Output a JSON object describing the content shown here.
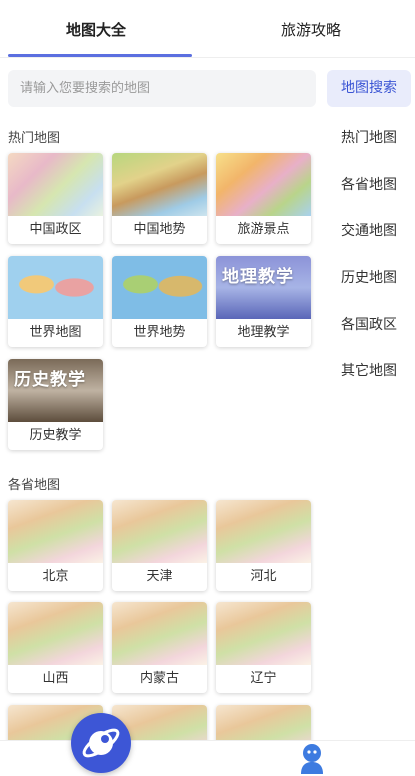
{
  "tabs": [
    {
      "label": "地图大全",
      "active": true
    },
    {
      "label": "旅游攻略",
      "active": false
    }
  ],
  "search": {
    "placeholder": "请输入您要搜索的地图",
    "button_label": "地图搜索"
  },
  "sections": {
    "hot": {
      "title": "热门地图",
      "items": [
        {
          "label": "中国政区",
          "image": "china-political-map"
        },
        {
          "label": "中国地势",
          "image": "china-terrain-map"
        },
        {
          "label": "旅游景点",
          "image": "tourist-attractions-map"
        },
        {
          "label": "世界地图",
          "image": "world-map"
        },
        {
          "label": "世界地势",
          "image": "world-terrain-map"
        },
        {
          "label": "地理教学",
          "image": "geography-teaching-poster",
          "poster_text": "地理教学"
        },
        {
          "label": "历史教学",
          "image": "history-teaching-poster",
          "poster_text": "历史教学"
        }
      ]
    },
    "provinces": {
      "title": "各省地图",
      "items": [
        {
          "label": "北京",
          "image": "beijing-map"
        },
        {
          "label": "天津",
          "image": "tianjin-map"
        },
        {
          "label": "河北",
          "image": "hebei-map"
        },
        {
          "label": "山西",
          "image": "shanxi-map"
        },
        {
          "label": "内蒙古",
          "image": "inner-mongolia-map"
        },
        {
          "label": "辽宁",
          "image": "liaoning-map"
        }
      ]
    }
  },
  "side_nav": [
    {
      "label": "热门地图"
    },
    {
      "label": "各省地图"
    },
    {
      "label": "交通地图"
    },
    {
      "label": "历史地图"
    },
    {
      "label": "各国政区"
    },
    {
      "label": "其它地图"
    }
  ],
  "bottom_nav": {
    "home_icon": "planet-icon",
    "profile_icon": "user-icon"
  },
  "colors": {
    "accent": "#5b6fe0",
    "search_button_bg": "#e9ecfb",
    "search_button_text": "#3b55d4",
    "home_button": "#3d56d6"
  }
}
